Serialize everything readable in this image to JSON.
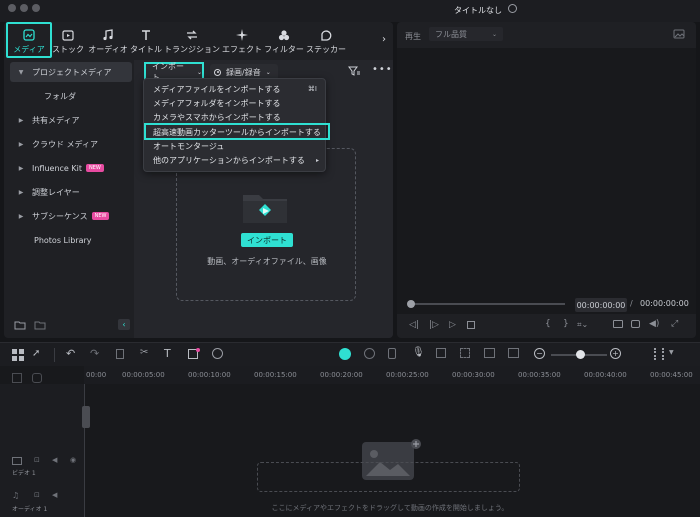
{
  "window": {
    "title": "タイトルなし"
  },
  "media_tabs": [
    {
      "label": "メディア",
      "icon": "media-icon"
    },
    {
      "label": "ストック",
      "icon": "stock-icon"
    },
    {
      "label": "オーディオ",
      "icon": "music-note-icon"
    },
    {
      "label": "タイトル",
      "icon": "title-t-icon"
    },
    {
      "label": "トランジション",
      "icon": "transition-icon"
    },
    {
      "label": "エフェクト",
      "icon": "effect-sparkle-icon"
    },
    {
      "label": "フィルター",
      "icon": "filter-icon"
    },
    {
      "label": "ステッカー",
      "icon": "sticker-icon"
    }
  ],
  "sidebar": {
    "items": [
      {
        "label": "プロジェクトメディア",
        "badge": ""
      },
      {
        "label": "フォルダ",
        "badge": ""
      },
      {
        "label": "共有メディア",
        "badge": ""
      },
      {
        "label": "クラウド メディア",
        "badge": ""
      },
      {
        "label": "Influence Kit",
        "badge": "NEW"
      },
      {
        "label": "調整レイヤー",
        "badge": ""
      },
      {
        "label": "サブシーケンス",
        "badge": "NEW"
      },
      {
        "label": "Photos Library",
        "badge": ""
      }
    ]
  },
  "toolbar": {
    "import_label": "インポート",
    "record_label": "録画/録音"
  },
  "import_menu": {
    "items": [
      {
        "label": "メディアファイルをインポートする",
        "shortcut": "⌘I"
      },
      {
        "label": "メディアフォルダをインポートする",
        "shortcut": ""
      },
      {
        "label": "カメラやスマホからインポートする",
        "shortcut": ""
      },
      {
        "label": "超高速動画カッターツールからインポートする",
        "shortcut": ""
      },
      {
        "label": "オートモンタージュ",
        "shortcut": ""
      },
      {
        "label": "他のアプリケーションからインポートする",
        "shortcut": "▸"
      }
    ]
  },
  "dropzone": {
    "button_label": "インポート",
    "caption": "動画、オーディオファイル、画像"
  },
  "preview": {
    "play_label": "再生",
    "quality_label": "フル品質",
    "current_time": "00:00:00:00",
    "separator": "/",
    "total_time": "00:00:00:00"
  },
  "timeline": {
    "ruler_ticks": [
      "00:00",
      "00:00:05:00",
      "00:00:10:00",
      "00:00:15:00",
      "00:00:20:00",
      "00:00:25:00",
      "00:00:30:00",
      "00:00:35:00",
      "00:00:40:00",
      "00:00:45:00"
    ],
    "video_track_label": "ビデオ 1",
    "audio_track_label": "オーディオ 1",
    "hint": "ここにメディアやエフェクトをドラッグして動画の作成を開始しましょう。"
  },
  "colors": {
    "accent": "#2fe0d2",
    "badge_new": "#e74ba1"
  }
}
